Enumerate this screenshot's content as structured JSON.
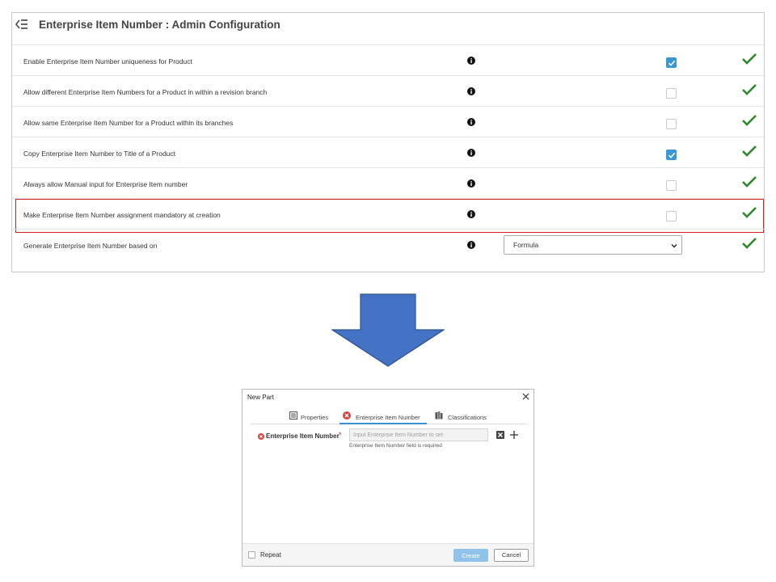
{
  "admin": {
    "title": "Enterprise Item Number : Admin Configuration",
    "rows": [
      {
        "label": "Enable Enterprise Item Number uniqueness for Product",
        "checked": true,
        "saved": true
      },
      {
        "label": "Allow different Enterprise Item Numbers for a Product in within a revision branch",
        "checked": false,
        "saved": true
      },
      {
        "label": "Allow same Enterprise Item Number for a Product within its branches",
        "checked": false,
        "saved": true
      },
      {
        "label": "Copy Enterprise Item Number to Title of a Product",
        "checked": true,
        "saved": true
      },
      {
        "label": "Always allow Manual input for Enterprise Item number",
        "checked": false,
        "saved": true
      },
      {
        "label": "Make Enterprise Item Number assignment mandatory at creation",
        "checked": false,
        "saved": true,
        "highlighted": true
      }
    ],
    "generate": {
      "label": "Generate Enterprise Item Number based on",
      "selected": "Formula"
    }
  },
  "colors": {
    "check_green": "#2b8a2b",
    "checkbox_blue": "#3a97d4",
    "highlight_red": "#d62020",
    "arrow_blue": "#4472c4",
    "error_red": "#d9443a"
  },
  "dialog": {
    "title": "New Part",
    "tabs": {
      "properties": "Properties",
      "ein": "Enterprise Item Number",
      "classifications": "Classifications"
    },
    "field": {
      "label": "Enterprise Item Number",
      "required_mark": "*",
      "placeholder": "Input Enterprise Item Number to set",
      "error": "Enterprise Item Number field is required"
    },
    "footer": {
      "repeat": "Repeat",
      "create": "Create",
      "cancel": "Cancel"
    }
  }
}
